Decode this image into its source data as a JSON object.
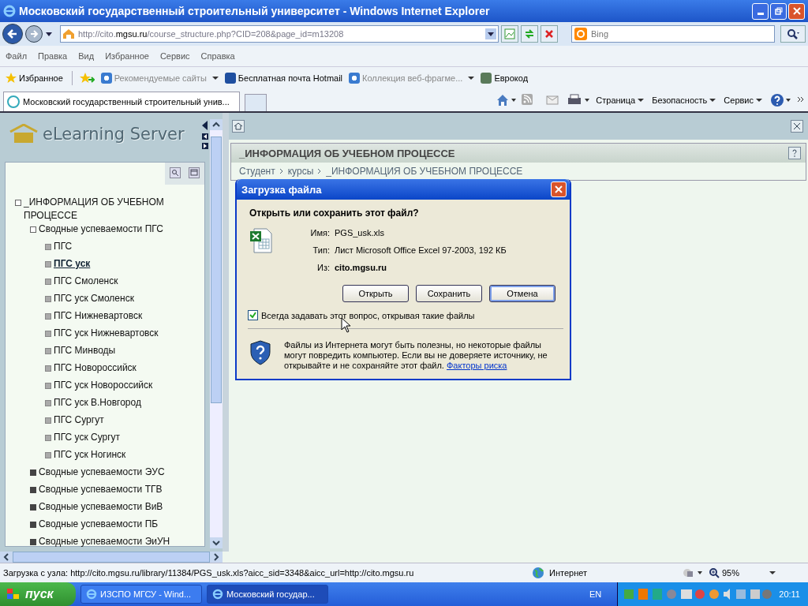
{
  "window": {
    "title": "Московский государственный строительный университет - Windows Internet Explorer"
  },
  "nav": {
    "address_host": "http://cito.",
    "address_domain": "mgsu.ru",
    "address_path": "/course_structure.php?CID=208&page_id=m13208",
    "search_placeholder": "Bing"
  },
  "menu": [
    "Файл",
    "Правка",
    "Вид",
    "Избранное",
    "Сервис",
    "Справка"
  ],
  "favorites": {
    "label": "Избранное",
    "links": [
      {
        "label": "Рекомендуемые сайты",
        "kind": "ie",
        "dropdown": true,
        "disabled": true
      },
      {
        "label": "Бесплатная почта Hotmail",
        "kind": "mail",
        "dropdown": false,
        "disabled": false
      },
      {
        "label": "Коллекция веб-фрагме...",
        "kind": "page",
        "dropdown": true,
        "disabled": true
      },
      {
        "label": "Еврокод",
        "kind": "book",
        "dropdown": false,
        "disabled": false
      }
    ]
  },
  "tabs": [
    {
      "label": "Московский государственный строительный унив...",
      "selected": true
    }
  ],
  "commands": [
    "Страница",
    "Безопасность",
    "Сервис"
  ],
  "sidebar": {
    "logo": "eLearning Server",
    "tree": [
      {
        "label": "_ИНФОРМАЦИЯ ОБ УЧЕБНОМ ПРОЦЕССЕ",
        "selected": false,
        "expanded": true,
        "children": [
          {
            "label": "Сводные успеваемости ПГС",
            "selected": false,
            "expanded": true,
            "children": [
              {
                "label": "ПГС",
                "selected": false
              },
              {
                "label": "ПГС уск",
                "selected": true
              },
              {
                "label": "ПГС Смоленск",
                "selected": false
              },
              {
                "label": "ПГС уск Смоленск",
                "selected": false
              },
              {
                "label": "ПГС Нижневартовск",
                "selected": false
              },
              {
                "label": "ПГС уск Нижневартовск",
                "selected": false
              },
              {
                "label": "ПГС Минводы",
                "selected": false
              },
              {
                "label": "ПГС Новороссийск",
                "selected": false
              },
              {
                "label": "ПГС уск Новороссийск",
                "selected": false
              },
              {
                "label": "ПГС уск В.Новгород",
                "selected": false
              },
              {
                "label": "ПГС Сургут",
                "selected": false
              },
              {
                "label": "ПГС уск Сургут",
                "selected": false
              },
              {
                "label": "ПГС уск Ногинск",
                "selected": false
              }
            ]
          },
          {
            "label": "Сводные успеваемости ЭУС",
            "selected": false,
            "expanded": false
          },
          {
            "label": "Сводные успеваемости ТГВ",
            "selected": false,
            "expanded": false
          },
          {
            "label": "Сводные успеваемости ВиВ",
            "selected": false,
            "expanded": false
          },
          {
            "label": "Сводные успеваемости ПБ",
            "selected": false,
            "expanded": false
          },
          {
            "label": "Сводные успеваемости ЭиУН",
            "selected": false,
            "expanded": false
          }
        ]
      }
    ]
  },
  "content": {
    "title": "_ИНФОРМАЦИЯ ОБ УЧЕБНОМ ПРОЦЕССЕ",
    "breadcrumb": [
      "Студент",
      "курсы",
      "_ИНФОРМАЦИЯ ОБ УЧЕБНОМ ПРОЦЕССЕ"
    ]
  },
  "dialog": {
    "title": "Загрузка файла",
    "question": "Открыть или сохранить этот файл?",
    "fields": [
      {
        "label": "Имя:",
        "value": "PGS_usk.xls",
        "bold": false
      },
      {
        "label": "Тип:",
        "value": "Лист Microsoft Office Excel 97-2003, 192 КБ",
        "bold": false
      },
      {
        "label": "Из:",
        "value": "cito.mgsu.ru",
        "bold": true
      }
    ],
    "buttons": [
      {
        "label": "Открыть",
        "selected": false
      },
      {
        "label": "Сохранить",
        "selected": false
      },
      {
        "label": "Отмена",
        "selected": true
      }
    ],
    "checkbox": {
      "label": "Всегда задавать этот вопрос, открывая такие файлы",
      "checked": true
    },
    "warning": "Файлы из Интернета могут быть полезны, но некоторые файлы могут повредить компьютер. Если вы не доверяете источнику, не открывайте и не сохраняйте этот файл.",
    "warning_link": "Факторы риска"
  },
  "status_bar": {
    "text": "Загрузка с узла: http://cito.mgsu.ru/library/11384/PGS_usk.xls?aicc_sid=3348&aicc_url=http://cito.mgsu.ru",
    "zone": "Интернет",
    "zoom": "95%"
  },
  "taskbar": {
    "start": "пуск",
    "tasks": [
      {
        "label": "ИЗСПО МГСУ - Wind...",
        "selected": false
      },
      {
        "label": "Московский государ...",
        "selected": true
      }
    ],
    "language": "EN",
    "clock": "20:11"
  }
}
